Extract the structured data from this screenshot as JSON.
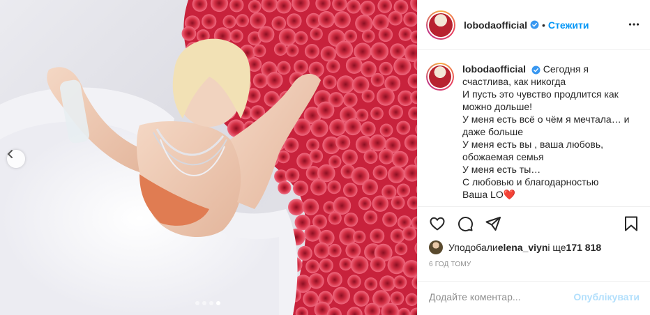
{
  "post": {
    "username": "lobodaofficial",
    "follow_separator": "•",
    "follow_label": "Стежити",
    "more_icon": "more-horizontal-icon",
    "caption_lines": [
      "Сегодня я",
      "счастлива, как никогда",
      "И пусть это чувство продлится как",
      "можно дольше!",
      "У меня есть всё о чём я мечтала… и",
      "даже больше",
      "У меня есть вы , ваша любовь,",
      "обожаемая семья",
      "У меня есть ты…",
      "С любовью и благодарностью",
      "Ваша LO❤️"
    ],
    "likes": {
      "prefix": "Уподобали ",
      "user": "elena_viyn",
      "middle": " і ще ",
      "count": "171 818"
    },
    "time": "6 год тому",
    "comment_placeholder": "Додайте коментар...",
    "publish_label": "Опублікувати"
  },
  "carousel": {
    "current": 4,
    "total": 4
  },
  "colors": {
    "accent": "#0095f6",
    "publish_disabled": "#b2dffc",
    "border": "#efefef",
    "muted": "#8e8e8e",
    "text": "#262626"
  }
}
